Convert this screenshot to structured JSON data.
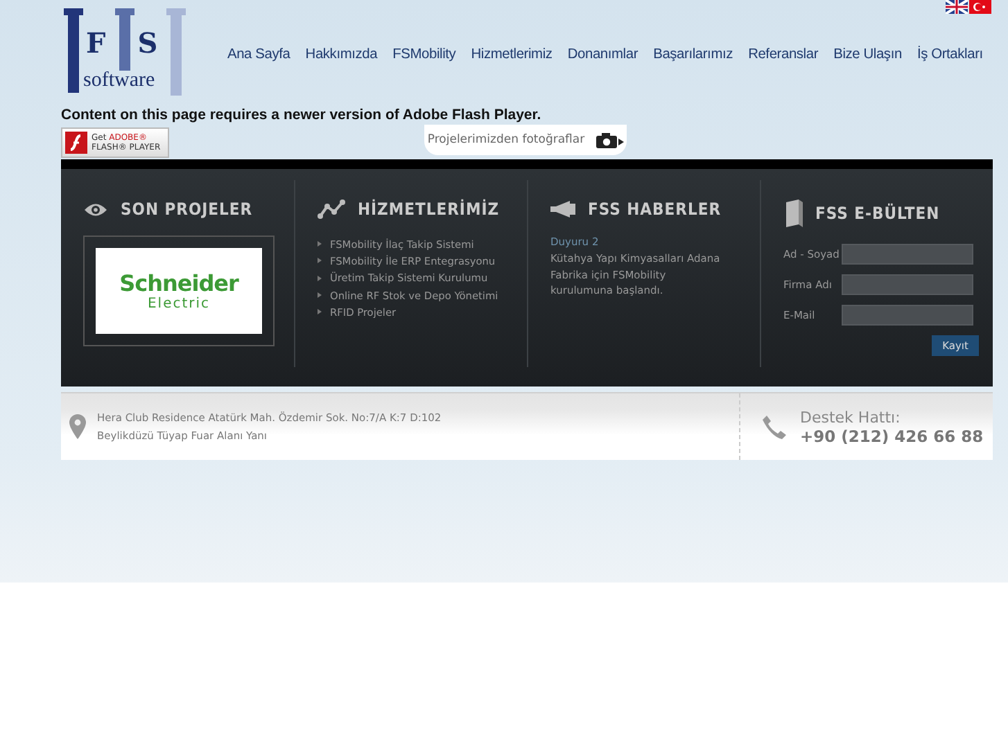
{
  "logo": {
    "letters": "FS",
    "word": "software"
  },
  "languages": [
    {
      "kind": "english"
    },
    {
      "kind": "turkish"
    }
  ],
  "nav": [
    "Ana Sayfa",
    "Hakkımızda",
    "FSMobility",
    "Hizmetlerimiz",
    "Donanımlar",
    "Başarılarımız",
    "Referanslar",
    "Bize Ulaşın",
    "İş Ortakları"
  ],
  "flash_notice": "Content on this page requires a newer version of Adobe Flash Player.",
  "flash_badge": {
    "line1": "Get",
    "brand": "ADOBE®",
    "line2": "FLASH® PLAYER"
  },
  "photos_button": "Projelerimizden fotoğraflar",
  "sections": [
    {
      "kind": "projects",
      "title": "SON PROJELER",
      "logo_top": "Schneider",
      "logo_bottom": "Electric"
    },
    {
      "kind": "services",
      "title": "HİZMETLERİMİZ",
      "items": [
        "FSMobility İlaç Takip Sistemi",
        "FSMobility İle ERP Entegrasyonu",
        "Üretim Takip Sistemi Kurulumu",
        "Online RF Stok ve Depo Yönetimi",
        "RFID Projeler"
      ]
    },
    {
      "kind": "news",
      "title": "FSS HABERLER",
      "headline": "Duyuru 2",
      "body": "Kütahya Yapı Kimyasalları Adana Fabrika için FSMobility kurulumuna başlandı."
    },
    {
      "kind": "newsletter",
      "title": "FSS E-BÜLTEN",
      "fields": [
        "Ad - Soyad",
        "Firma Adı",
        "E-Mail"
      ],
      "button": "Kayıt"
    }
  ],
  "footer": {
    "address_line1": "Hera Club Residence Atatürk Mah. Özdemir Sok. No:7/A K:7 D:102",
    "address_line2": "Beylikdüzü Tüyap Fuar Alanı Yanı",
    "support_label": "Destek Hattı:",
    "support_phone": "+90 (212) 426 66 88"
  }
}
